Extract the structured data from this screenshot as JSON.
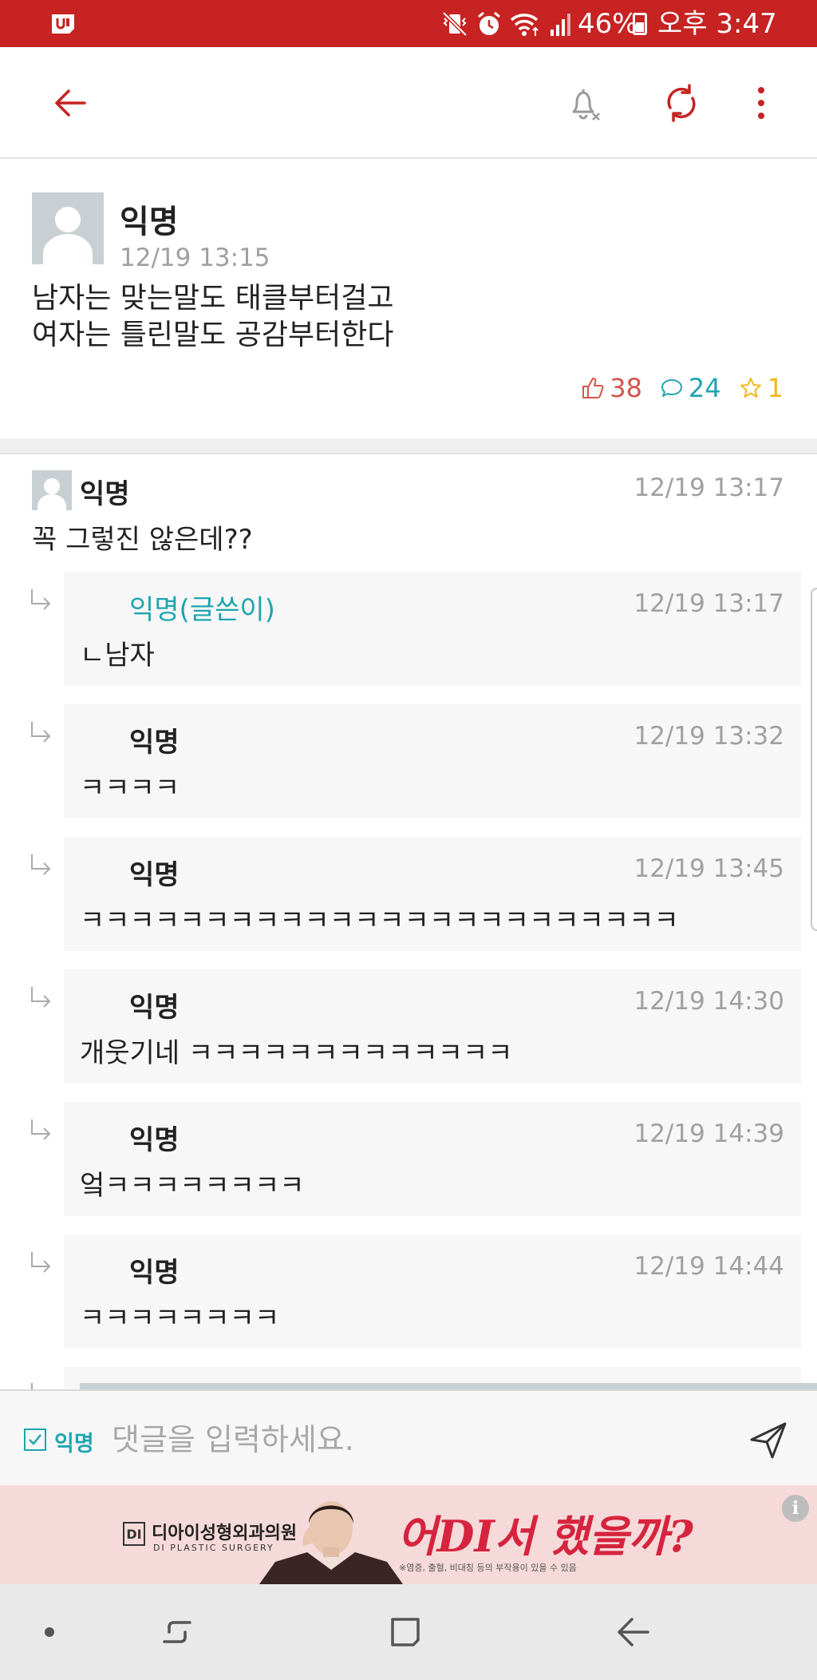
{
  "status_bar": {
    "battery_percent": "46%",
    "time": "오후 3:47",
    "color": "#c62322"
  },
  "toolbar": {
    "icons": [
      "back-arrow-icon",
      "notification-off-icon",
      "refresh-icon",
      "more-vert-icon"
    ],
    "accent": "#c62322"
  },
  "post": {
    "author": "익명",
    "time": "12/19 13:15",
    "lines": [
      "남자는 맞는말도 태클부터걸고",
      "여자는 틀린말도 공감부터한다"
    ],
    "likes": "38",
    "comments": "24",
    "scraps": "1"
  },
  "comments": [
    {
      "author": "익명",
      "time": "12/19 13:17",
      "text": "꼭 그렇진 않은데??"
    }
  ],
  "replies": [
    {
      "author": "익명(글쓴이)",
      "time": "12/19 13:17",
      "text": "ㄴ남자",
      "is_op": true
    },
    {
      "author": "익명",
      "time": "12/19 13:32",
      "text": "ㅋㅋㅋㅋ"
    },
    {
      "author": "익명",
      "time": "12/19 13:45",
      "text": "ㅋㅋㅋㅋㅋㅋㅋㅋㅋㅋㅋㅋㅋㅋㅋㅋㅋㅋㅋㅋㅋㅋㅋㅋ"
    },
    {
      "author": "익명",
      "time": "12/19 14:30",
      "text": "개웃기네 ㅋㅋㅋㅋㅋㅋㅋㅋㅋㅋㅋㅋㅋ"
    },
    {
      "author": "익명",
      "time": "12/19 14:39",
      "text": "엌ㅋㅋㅋㅋㅋㅋㅋㅋ"
    },
    {
      "author": "익명",
      "time": "12/19 14:44",
      "text": "ㅋㅋㅋㅋㅋㅋㅋㅋ"
    }
  ],
  "input_bar": {
    "anonymous_label": "익명",
    "anonymous_checked": true,
    "placeholder": "댓글을 입력하세요."
  },
  "ad": {
    "clinic_name": "디아이성형외과의원",
    "clinic_subtitle": "DI PLASTIC SURGERY",
    "headline": "어DI서 했을까?",
    "disclaimer": "※염증, 출혈, 비대칭 등의 부작용이 있을 수 있음"
  },
  "colors": {
    "accent_red": "#c62322",
    "teal": "#1ea5b0",
    "like_red": "#d4564c",
    "star_yellow": "#f2b81c"
  }
}
